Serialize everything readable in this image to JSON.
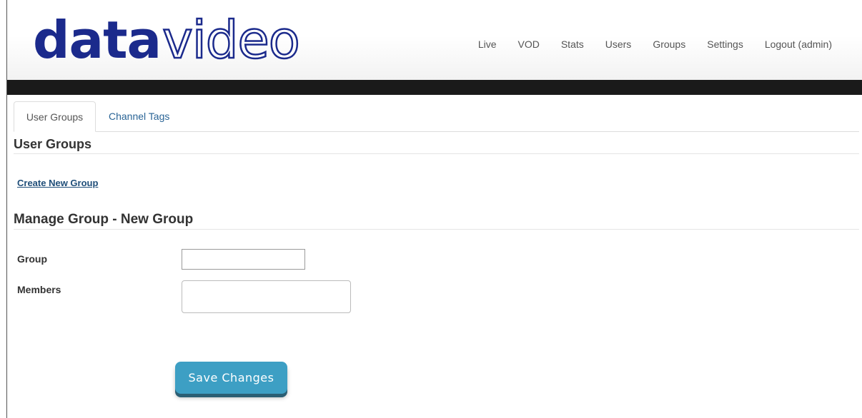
{
  "header": {
    "logo_part1": "data",
    "logo_part2": "video",
    "nav": {
      "live": "Live",
      "vod": "VOD",
      "stats": "Stats",
      "users": "Users",
      "groups": "Groups",
      "settings": "Settings",
      "logout": "Logout (admin)"
    }
  },
  "tabs": {
    "user_groups": "User Groups",
    "channel_tags": "Channel Tags",
    "active": "User Groups"
  },
  "user_groups_section": {
    "title": "User Groups",
    "create_link": "Create New Group"
  },
  "manage_section": {
    "title": "Manage Group - New Group",
    "group_label": "Group",
    "group_value": "",
    "members_label": "Members",
    "members_value": "",
    "save_label": "Save Changes"
  },
  "colors": {
    "brand": "#1b2a8c",
    "link": "#2a6496",
    "button": "#3d9fc4",
    "dark_bar": "#1a1a1a"
  }
}
